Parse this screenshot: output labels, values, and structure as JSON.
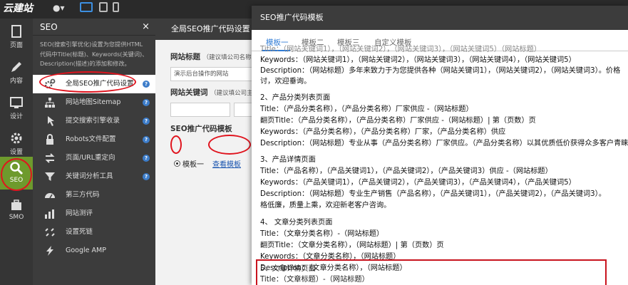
{
  "logo": {
    "text": "云建站"
  },
  "rail": {
    "items": [
      {
        "label": "页面"
      },
      {
        "label": "内容"
      },
      {
        "label": "设计"
      },
      {
        "label": "设置"
      },
      {
        "label": "SEO"
      },
      {
        "label": "SMO"
      }
    ]
  },
  "sidebar": {
    "title": "SEO",
    "close": "×",
    "description": "SEO(搜索引擎优化)设置为您提供HTML代码中Title(标题)、Keywords(关键词)、Description(描述)的添加和修改。",
    "items": [
      {
        "label": "全局SEO推广代码设置"
      },
      {
        "label": "网站地图Sitemap"
      },
      {
        "label": "提交搜索引擎收录"
      },
      {
        "label": "Robots文件配置"
      },
      {
        "label": "页面/URL重定向"
      },
      {
        "label": "关键词分析工具"
      },
      {
        "label": "第三方代码"
      },
      {
        "label": "网站测评"
      },
      {
        "label": "设置死链"
      },
      {
        "label": "Google AMP"
      }
    ]
  },
  "mid": {
    "title": "全局SEO推广代码设置",
    "site_title_label": "网站标题",
    "site_title_hint": "（建议填公司名称",
    "site_title_value": "演示后台操作的网站",
    "keywords_label": "网站关键词",
    "keywords_hint": "（建议填公司主",
    "template_label": "SEO推广代码模板",
    "radio_label": "模板一",
    "view_link": "查看模板"
  },
  "modal": {
    "title": "SEO推广代码模板",
    "tabs": [
      "模板一",
      "模板二",
      "模板三",
      "自定义模板"
    ],
    "lines": [
      "Title：（网站关键词1），（网站关键词2），（网站关键词3），（网站关键词5）（网站标题）",
      "Keywords：（网站关键词1），（网站关键词2），（网站关键词3），（网站关键词4），（网站关键词5）",
      "Description：（网站标题）多年来致力于为您提供各种（网站关键词1），（网站关键词2），（网站关键词3）。价格",
      "讨，欢迎垂询。",
      "",
      "2、产品分类列表页面",
      "Title：（产品分类名称），（产品分类名称）厂家供应 -（网站标题）",
      "翻页Title：（产品分类名称），（产品分类名称）厂家供应 -（网站标题）| 第（页数）页",
      "Keywords：（产品分类名称），（产品分类名称）厂家，（产品分类名称）供应",
      "Description：（网站标题）专业从事（产品分类名称）厂家供应。（产品分类名称）以其优质低价获得众多客户青睐",
      "",
      "3、产品详情页面",
      "Title：（产品名称），（产品关键词1），（产品关键词2），（产品关键词3）供应 -（网站标题）",
      "Keywords：（产品关键词1），（产品关键词2），（产品关键词3），（产品关键词4），（产品关键词5）",
      "Description：（网站标题）专业生产销售（产品名称），（产品关键词1），（产品关键词2），（产品关键词3）。",
      "格低廉，质量上乘，欢迎新老客户咨询。",
      "",
      "4、 文章分类列表页面",
      "Title：（文章分类名称）-（网站标题）",
      "翻页Title：（文章分类名称），（网站标题）| 第（页数）页",
      "Keywords：（文章分类名称），（网站标题）",
      "Description：（文章分类名称），（网站标题）",
      "",
      "5、文章详情页面",
      "Title：（文章标题）-（网站标题）"
    ]
  }
}
